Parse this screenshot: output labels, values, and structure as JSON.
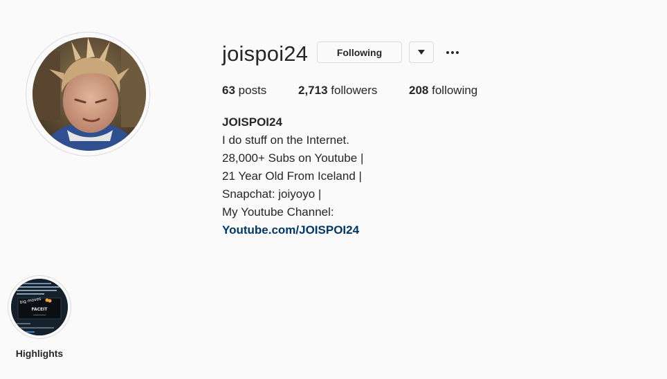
{
  "profile": {
    "username": "joispoi24",
    "follow_label": "Following",
    "more_icon": "ellipsis-icon",
    "dropdown_icon": "caret-down-icon"
  },
  "stats": {
    "posts_count": "63",
    "posts_label": "posts",
    "followers_count": "2,713",
    "followers_label": "followers",
    "following_count": "208",
    "following_label": "following"
  },
  "bio": {
    "name": "JOISPOI24",
    "lines": [
      "I do stuff on the Internet.",
      "28,000+ Subs on Youtube |",
      "21 Year Old From Iceland |",
      "Snapchat: joiyoyo |",
      "My Youtube Channel:"
    ],
    "link": "Youtube.com/JOISPOI24"
  },
  "highlights": [
    {
      "label": "Highlights",
      "thumb_text": "FACEIT"
    }
  ],
  "colors": {
    "background": "#fafafa",
    "text": "#262626",
    "link": "#00376b",
    "border": "#dbdbdb"
  }
}
